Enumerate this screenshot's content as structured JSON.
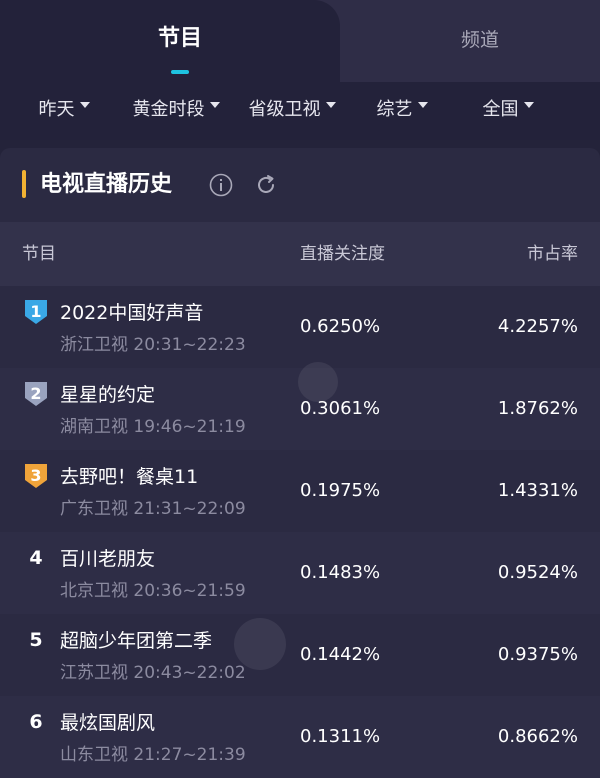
{
  "tabs": [
    {
      "label": "节目",
      "active": true
    },
    {
      "label": "频道",
      "active": false
    }
  ],
  "filters": [
    {
      "label": "昨天"
    },
    {
      "label": "黄金时段"
    },
    {
      "label": "省级卫视"
    },
    {
      "label": "综艺"
    },
    {
      "label": "全国"
    }
  ],
  "section": {
    "title": "电视直播历史",
    "info_icon": "info-icon",
    "refresh_icon": "refresh-icon"
  },
  "table": {
    "headers": {
      "program": "节目",
      "attention": "直播关注度",
      "share": "市占率"
    },
    "rows": [
      {
        "rank": "1",
        "name": "2022中国好声音",
        "channel_time": "浙江卫视 20:31~22:23",
        "attention": "0.6250%",
        "share": "4.2257%",
        "badge": "#3aa8e6"
      },
      {
        "rank": "2",
        "name": "星星的约定",
        "channel_time": "湖南卫视 19:46~21:19",
        "attention": "0.3061%",
        "share": "1.8762%",
        "badge": "#9aa3bf"
      },
      {
        "rank": "3",
        "name": "去野吧！餐桌11",
        "channel_time": "广东卫视 21:31~22:09",
        "attention": "0.1975%",
        "share": "1.4331%",
        "badge": "#f0a43a"
      },
      {
        "rank": "4",
        "name": "百川老朋友",
        "channel_time": "北京卫视 20:36~21:59",
        "attention": "0.1483%",
        "share": "0.9524%"
      },
      {
        "rank": "5",
        "name": "超脑少年团第二季",
        "channel_time": "江苏卫视 20:43~22:02",
        "attention": "0.1442%",
        "share": "0.9375%"
      },
      {
        "rank": "6",
        "name": "最炫国剧风",
        "channel_time": "山东卫视 21:27~21:39",
        "attention": "0.1311%",
        "share": "0.8662%"
      }
    ]
  },
  "colors": {
    "accent": "#1ec3e0",
    "section_bar": "#f2b233",
    "background": "#24233a"
  }
}
